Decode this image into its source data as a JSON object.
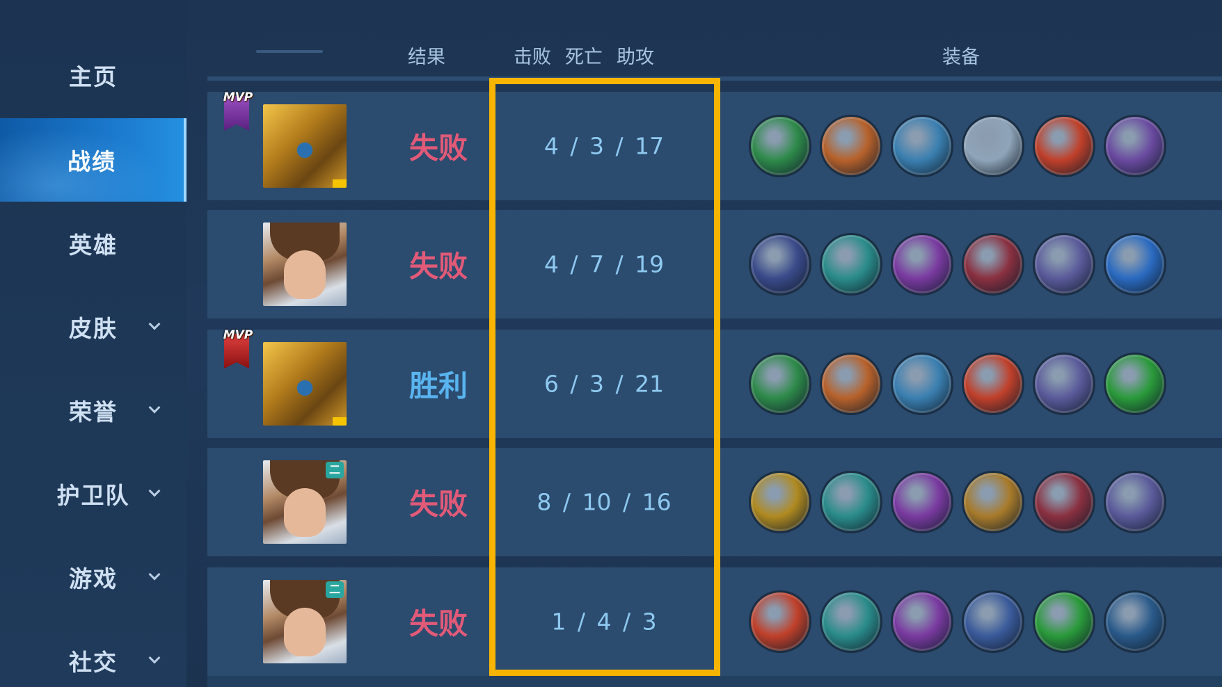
{
  "sidebar": {
    "items": [
      {
        "label": "主页",
        "active": false,
        "has_chevron": false
      },
      {
        "label": "战绩",
        "active": true,
        "has_chevron": false
      },
      {
        "label": "英雄",
        "active": false,
        "has_chevron": false
      },
      {
        "label": "皮肤",
        "active": false,
        "has_chevron": true
      },
      {
        "label": "荣誉",
        "active": false,
        "has_chevron": true
      },
      {
        "label": "护卫队",
        "active": false,
        "has_chevron": true
      },
      {
        "label": "游戏",
        "active": false,
        "has_chevron": true
      },
      {
        "label": "社交",
        "active": false,
        "has_chevron": true
      }
    ]
  },
  "table": {
    "headers": {
      "result": "结果",
      "kills": "击败",
      "deaths": "死亡",
      "assists": "助攻",
      "equipment": "装备"
    },
    "rows": [
      {
        "mvp": "MVP",
        "mvp_color": "purple",
        "hero": "gold-armored-hero",
        "badge": "",
        "result": "失败",
        "outcome": "lose",
        "kda": "4 / 3 / 17",
        "items": [
          "#2e8a4a",
          "#b7612a",
          "#3a7fb0",
          "#8fa4b8",
          "#c0402a",
          "#6a4aa0"
        ]
      },
      {
        "mvp": "",
        "mvp_color": "",
        "hero": "brown-haired-hero",
        "badge": "",
        "result": "失败",
        "outcome": "lose",
        "kda": "4 / 7 / 19",
        "items": [
          "#3a4a8a",
          "#2a8c8a",
          "#7a3aa0",
          "#8a3040",
          "#5a5a9a",
          "#2a6ac0"
        ]
      },
      {
        "mvp": "MVP",
        "mvp_color": "red",
        "hero": "gold-armored-hero",
        "badge": "",
        "result": "胜利",
        "outcome": "win",
        "kda": "6 / 3 / 21",
        "items": [
          "#2e8a4a",
          "#b7612a",
          "#3a7fb0",
          "#c0402a",
          "#5a5a9a",
          "#2a9a3a"
        ]
      },
      {
        "mvp": "",
        "mvp_color": "",
        "hero": "brown-haired-hero",
        "badge": "二",
        "result": "失败",
        "outcome": "lose",
        "kda": "8 / 10 / 16",
        "items": [
          "#b08a20",
          "#2a8c8a",
          "#7a3aa0",
          "#a87a2a",
          "#8a3040",
          "#5a5a9a"
        ]
      },
      {
        "mvp": "",
        "mvp_color": "",
        "hero": "brown-haired-hero",
        "badge": "二",
        "result": "失败",
        "outcome": "lose",
        "kda": "1 / 4 / 3",
        "items": [
          "#c0402a",
          "#2a8c8a",
          "#7a3aa0",
          "#3a5a9a",
          "#2a9a3a",
          "#2a5a8a"
        ]
      }
    ]
  },
  "highlight_color": "#f7b500"
}
